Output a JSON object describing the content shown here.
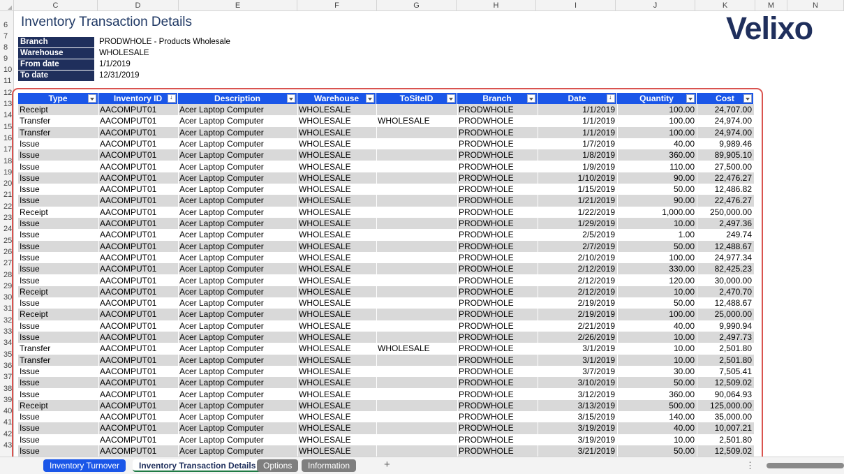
{
  "columns": [
    "C",
    "D",
    "E",
    "F",
    "G",
    "H",
    "I",
    "J",
    "K",
    "M",
    "N"
  ],
  "title": "Inventory Transaction Details",
  "logo": "Velixo",
  "info": [
    {
      "label": "Branch",
      "value": "PRODWHOLE - Products Wholesale"
    },
    {
      "label": "Warehouse",
      "value": "WHOLESALE"
    },
    {
      "label": "From date",
      "value": "1/1/2019"
    },
    {
      "label": "To date",
      "value": "12/31/2019"
    }
  ],
  "row_numbers": [
    "6",
    "7",
    "8",
    "9",
    "10",
    "11",
    "12",
    "13",
    "14",
    "15",
    "16",
    "17",
    "18",
    "19",
    "20",
    "21",
    "22",
    "23",
    "24",
    "25",
    "26",
    "27",
    "28",
    "29",
    "30",
    "31",
    "32",
    "33",
    "34",
    "35",
    "36",
    "37",
    "38",
    "39",
    "40",
    "41",
    "42",
    "43"
  ],
  "table": {
    "headers": [
      "Type",
      "Inventory ID",
      "Description",
      "Warehouse",
      "ToSiteID",
      "Branch",
      "Date",
      "Quantity",
      "Cost"
    ],
    "rows": [
      [
        "Receipt",
        "AACOMPUT01",
        "Acer Laptop Computer",
        "WHOLESALE",
        "",
        "PRODWHOLE",
        "1/1/2019",
        "100.00",
        "24,707.00"
      ],
      [
        "Transfer",
        "AACOMPUT01",
        "Acer Laptop Computer",
        "WHOLESALE",
        "WHOLESALE",
        "PRODWHOLE",
        "1/1/2019",
        "100.00",
        "24,974.00"
      ],
      [
        "Transfer",
        "AACOMPUT01",
        "Acer Laptop Computer",
        "WHOLESALE",
        "",
        "PRODWHOLE",
        "1/1/2019",
        "100.00",
        "24,974.00"
      ],
      [
        "Issue",
        "AACOMPUT01",
        "Acer Laptop Computer",
        "WHOLESALE",
        "",
        "PRODWHOLE",
        "1/7/2019",
        "40.00",
        "9,989.46"
      ],
      [
        "Issue",
        "AACOMPUT01",
        "Acer Laptop Computer",
        "WHOLESALE",
        "",
        "PRODWHOLE",
        "1/8/2019",
        "360.00",
        "89,905.10"
      ],
      [
        "Issue",
        "AACOMPUT01",
        "Acer Laptop Computer",
        "WHOLESALE",
        "",
        "PRODWHOLE",
        "1/9/2019",
        "110.00",
        "27,500.00"
      ],
      [
        "Issue",
        "AACOMPUT01",
        "Acer Laptop Computer",
        "WHOLESALE",
        "",
        "PRODWHOLE",
        "1/10/2019",
        "90.00",
        "22,476.27"
      ],
      [
        "Issue",
        "AACOMPUT01",
        "Acer Laptop Computer",
        "WHOLESALE",
        "",
        "PRODWHOLE",
        "1/15/2019",
        "50.00",
        "12,486.82"
      ],
      [
        "Issue",
        "AACOMPUT01",
        "Acer Laptop Computer",
        "WHOLESALE",
        "",
        "PRODWHOLE",
        "1/21/2019",
        "90.00",
        "22,476.27"
      ],
      [
        "Receipt",
        "AACOMPUT01",
        "Acer Laptop Computer",
        "WHOLESALE",
        "",
        "PRODWHOLE",
        "1/22/2019",
        "1,000.00",
        "250,000.00"
      ],
      [
        "Issue",
        "AACOMPUT01",
        "Acer Laptop Computer",
        "WHOLESALE",
        "",
        "PRODWHOLE",
        "1/29/2019",
        "10.00",
        "2,497.36"
      ],
      [
        "Issue",
        "AACOMPUT01",
        "Acer Laptop Computer",
        "WHOLESALE",
        "",
        "PRODWHOLE",
        "2/5/2019",
        "1.00",
        "249.74"
      ],
      [
        "Issue",
        "AACOMPUT01",
        "Acer Laptop Computer",
        "WHOLESALE",
        "",
        "PRODWHOLE",
        "2/7/2019",
        "50.00",
        "12,488.67"
      ],
      [
        "Issue",
        "AACOMPUT01",
        "Acer Laptop Computer",
        "WHOLESALE",
        "",
        "PRODWHOLE",
        "2/10/2019",
        "100.00",
        "24,977.34"
      ],
      [
        "Issue",
        "AACOMPUT01",
        "Acer Laptop Computer",
        "WHOLESALE",
        "",
        "PRODWHOLE",
        "2/12/2019",
        "330.00",
        "82,425.23"
      ],
      [
        "Issue",
        "AACOMPUT01",
        "Acer Laptop Computer",
        "WHOLESALE",
        "",
        "PRODWHOLE",
        "2/12/2019",
        "120.00",
        "30,000.00"
      ],
      [
        "Receipt",
        "AACOMPUT01",
        "Acer Laptop Computer",
        "WHOLESALE",
        "",
        "PRODWHOLE",
        "2/12/2019",
        "10.00",
        "2,470.70"
      ],
      [
        "Issue",
        "AACOMPUT01",
        "Acer Laptop Computer",
        "WHOLESALE",
        "",
        "PRODWHOLE",
        "2/19/2019",
        "50.00",
        "12,488.67"
      ],
      [
        "Receipt",
        "AACOMPUT01",
        "Acer Laptop Computer",
        "WHOLESALE",
        "",
        "PRODWHOLE",
        "2/19/2019",
        "100.00",
        "25,000.00"
      ],
      [
        "Issue",
        "AACOMPUT01",
        "Acer Laptop Computer",
        "WHOLESALE",
        "",
        "PRODWHOLE",
        "2/21/2019",
        "40.00",
        "9,990.94"
      ],
      [
        "Issue",
        "AACOMPUT01",
        "Acer Laptop Computer",
        "WHOLESALE",
        "",
        "PRODWHOLE",
        "2/26/2019",
        "10.00",
        "2,497.73"
      ],
      [
        "Transfer",
        "AACOMPUT01",
        "Acer Laptop Computer",
        "WHOLESALE",
        "WHOLESALE",
        "PRODWHOLE",
        "3/1/2019",
        "10.00",
        "2,501.80"
      ],
      [
        "Transfer",
        "AACOMPUT01",
        "Acer Laptop Computer",
        "WHOLESALE",
        "",
        "PRODWHOLE",
        "3/1/2019",
        "10.00",
        "2,501.80"
      ],
      [
        "Issue",
        "AACOMPUT01",
        "Acer Laptop Computer",
        "WHOLESALE",
        "",
        "PRODWHOLE",
        "3/7/2019",
        "30.00",
        "7,505.41"
      ],
      [
        "Issue",
        "AACOMPUT01",
        "Acer Laptop Computer",
        "WHOLESALE",
        "",
        "PRODWHOLE",
        "3/10/2019",
        "50.00",
        "12,509.02"
      ],
      [
        "Issue",
        "AACOMPUT01",
        "Acer Laptop Computer",
        "WHOLESALE",
        "",
        "PRODWHOLE",
        "3/12/2019",
        "360.00",
        "90,064.93"
      ],
      [
        "Receipt",
        "AACOMPUT01",
        "Acer Laptop Computer",
        "WHOLESALE",
        "",
        "PRODWHOLE",
        "3/13/2019",
        "500.00",
        "125,000.00"
      ],
      [
        "Issue",
        "AACOMPUT01",
        "Acer Laptop Computer",
        "WHOLESALE",
        "",
        "PRODWHOLE",
        "3/15/2019",
        "140.00",
        "35,000.00"
      ],
      [
        "Issue",
        "AACOMPUT01",
        "Acer Laptop Computer",
        "WHOLESALE",
        "",
        "PRODWHOLE",
        "3/19/2019",
        "40.00",
        "10,007.21"
      ],
      [
        "Issue",
        "AACOMPUT01",
        "Acer Laptop Computer",
        "WHOLESALE",
        "",
        "PRODWHOLE",
        "3/19/2019",
        "10.00",
        "2,501.80"
      ],
      [
        "Issue",
        "AACOMPUT01",
        "Acer Laptop Computer",
        "WHOLESALE",
        "",
        "PRODWHOLE",
        "3/21/2019",
        "50.00",
        "12,509.02"
      ]
    ]
  },
  "sheet_tabs": [
    {
      "label": "Inventory Turnover",
      "style": "blue"
    },
    {
      "label": "Inventory Transaction Details",
      "style": "active"
    },
    {
      "label": "Options",
      "style": "gray"
    },
    {
      "label": "Information",
      "style": "gray"
    }
  ],
  "add_sheet": "+",
  "more": "⋮"
}
